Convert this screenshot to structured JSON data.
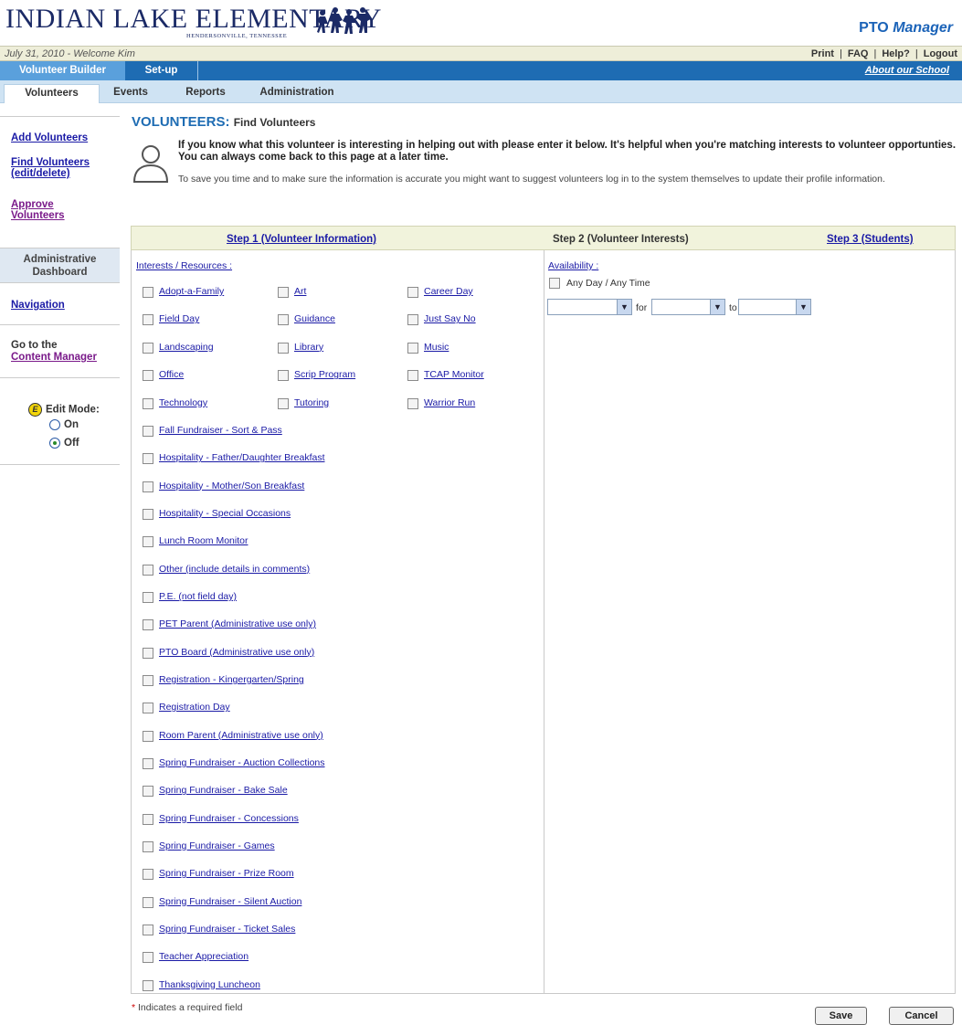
{
  "header": {
    "logo_text": "INDIAN LAKE ELEMENTARY",
    "logo_subtext": "HENDERSONVILLE, TENNESSEE",
    "product_name": "PTO",
    "product_suffix": "Manager"
  },
  "infobar": {
    "date": "July 31, 2010 - Welcome Kim",
    "links": [
      "Print",
      "FAQ",
      "Help?",
      "Logout"
    ],
    "sep": "|"
  },
  "main_tabs": {
    "active": "Volunteer Builder",
    "other": "Set-up",
    "about": "About our School"
  },
  "sub_tabs": [
    "Volunteers",
    "Events",
    "Reports",
    "Administration"
  ],
  "leftnav": {
    "add": "Add Volunteers",
    "find_1": "Find Volunteers",
    "find_2": "(edit/delete)",
    "approve_1": "Approve",
    "approve_2": "Volunteers",
    "dashboard_1": "Administrative",
    "dashboard_2": "Dashboard",
    "navigation": "Navigation",
    "goto_1": "Go to the",
    "goto_2": "Content Manager",
    "edit_icon": "E",
    "edit_mode": "Edit Mode:",
    "on": "On",
    "off": "Off",
    "selected": "Off"
  },
  "page": {
    "title": "VOLUNTEERS:",
    "subtitle": "Find Volunteers",
    "intro_bold": "If you know what this volunteer is interesting in helping out with please enter it below. It's helpful when you're matching interests to volunteer opportunties. You can always come back to this page at a later time.",
    "intro_note": "To save you time and to make sure the information is accurate you might want to suggest volunteers log in to the system themselves to update their profile information."
  },
  "steps": {
    "step1": "Step 1 (Volunteer Information)",
    "step2": "Step 2 (Volunteer Interests)",
    "step3": "Step 3 (Students)"
  },
  "interests": {
    "label": "Interests / Resources :",
    "grid": [
      "Adopt-a-Family",
      "Art",
      "Career Day",
      "Field Day",
      "Guidance",
      "Just Say No",
      "Landscaping",
      "Library",
      "Music",
      "Office",
      "Scrip Program",
      "TCAP Monitor",
      "Technology",
      "Tutoring",
      "Warrior Run"
    ],
    "list": [
      "Fall Fundraiser - Sort & Pass",
      "Hospitality - Father/Daughter Breakfast",
      "Hospitality - Mother/Son Breakfast",
      "Hospitality - Special Occasions",
      "Lunch Room Monitor",
      "Other (include details in comments)",
      "P.E. (not field day)",
      "PET Parent (Administrative use only)",
      "PTO Board (Administrative use only)",
      "Registration - Kingergarten/Spring",
      "Registration Day",
      "Room Parent (Administrative use only)",
      "Spring Fundraiser - Auction Collections",
      "Spring Fundraiser - Bake Sale",
      "Spring Fundraiser - Concessions",
      "Spring Fundraiser - Games",
      "Spring Fundraiser - Prize Room",
      "Spring Fundraiser - Silent Auction",
      "Spring Fundraiser - Ticket Sales",
      "Teacher Appreciation",
      "Thanksgiving Luncheon"
    ]
  },
  "availability": {
    "label": "Availability :",
    "any": "Any Day / Any Time",
    "for": "for",
    "to": "to",
    "day_value": "",
    "from_value": "",
    "to_value": ""
  },
  "footer": {
    "req_star": "*",
    "required_note": "Indicates a required field",
    "save": "Save",
    "cancel": "Cancel"
  }
}
